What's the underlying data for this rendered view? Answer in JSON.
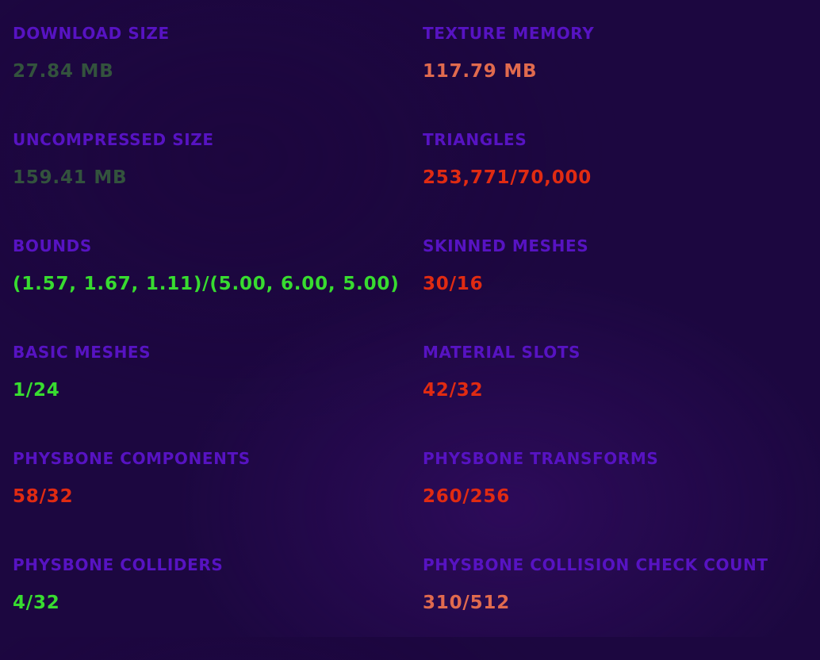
{
  "colors": {
    "background": "#1c0740",
    "label": "#5713c2",
    "neutral": "#33533d",
    "good": "#38dc30",
    "warn": "#e06a4e",
    "bad": "#e02b12"
  },
  "stats": [
    {
      "label": "DOWNLOAD SIZE",
      "value": "27.84 MB",
      "status": "neutral"
    },
    {
      "label": "TEXTURE MEMORY",
      "value": "117.79 MB",
      "status": "warn"
    },
    {
      "label": "UNCOMPRESSED SIZE",
      "value": "159.41 MB",
      "status": "neutral"
    },
    {
      "label": "TRIANGLES",
      "value": "253,771/70,000",
      "status": "bad"
    },
    {
      "label": "BOUNDS",
      "value": "(1.57, 1.67, 1.11)/(5.00, 6.00, 5.00)",
      "status": "good"
    },
    {
      "label": "SKINNED MESHES",
      "value": "30/16",
      "status": "bad"
    },
    {
      "label": "BASIC MESHES",
      "value": "1/24",
      "status": "good"
    },
    {
      "label": "MATERIAL SLOTS",
      "value": "42/32",
      "status": "bad"
    },
    {
      "label": "PHYSBONE COMPONENTS",
      "value": "58/32",
      "status": "bad"
    },
    {
      "label": "PHYSBONE TRANSFORMS",
      "value": "260/256",
      "status": "bad"
    },
    {
      "label": "PHYSBONE COLLIDERS",
      "value": "4/32",
      "status": "good"
    },
    {
      "label": "PHYSBONE COLLISION CHECK COUNT",
      "value": "310/512",
      "status": "warn"
    }
  ]
}
